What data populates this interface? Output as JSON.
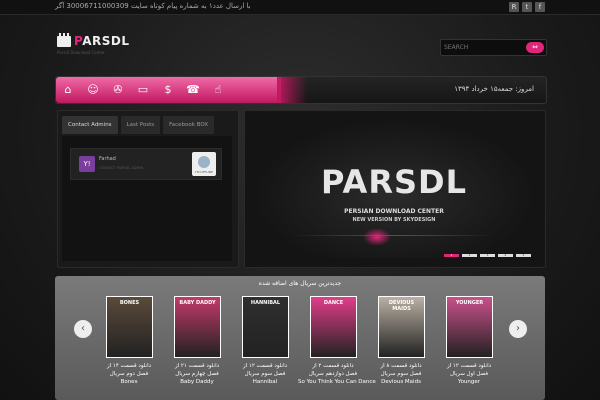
{
  "top_bar": {
    "message": "با ارسال عدد۱ به شماره پیام کوتاه سایت 30006711000309 آگر",
    "social": [
      {
        "icon": "rss-icon",
        "glyph": "R"
      },
      {
        "icon": "twitter-icon",
        "glyph": "t"
      },
      {
        "icon": "facebook-icon",
        "glyph": "f"
      }
    ]
  },
  "header": {
    "logo_initial": "P",
    "logo_rest": "ARSDL",
    "tagline": "Parsdl Download Center",
    "search_placeholder": "SEARCH",
    "search_button": "⇔"
  },
  "nav": {
    "items": [
      {
        "icon": "home-icon",
        "glyph": "⌂"
      },
      {
        "icon": "users-icon",
        "glyph": "☺"
      },
      {
        "icon": "film-reel-icon",
        "glyph": "✇"
      },
      {
        "icon": "tv-icon",
        "glyph": "▭"
      },
      {
        "icon": "dollar-icon",
        "glyph": "$"
      },
      {
        "icon": "phone-icon",
        "glyph": "☎"
      },
      {
        "icon": "hand-pointer-icon",
        "glyph": "☝"
      }
    ],
    "date": "امروز: جمعه۱۵ خرداد ۱۳۹۴"
  },
  "tabs_panel": {
    "tabs": [
      "Contact Admins",
      "Last Posts",
      "Facebook BOX"
    ],
    "admin": {
      "yahoo_glyph": "Y!",
      "name": "Farhad",
      "subtitle": "CONTACT PARSDL ADMIN",
      "status": "I'M OFFLINE"
    }
  },
  "slider": {
    "title": "PARSDL",
    "subtitle1": "PERSIAN DOWNLOAD CENTER",
    "subtitle2": "NEW VERSION BY SKYDESIGN",
    "dots": [
      "1",
      "2",
      "3",
      "4",
      "5"
    ],
    "active_index": 0
  },
  "series": {
    "title": "جدیدترین سریال های اضافه شده",
    "items": [
      {
        "line1": "دانلود قسمت ۱۴ از",
        "line2": "فصل دوم سریال",
        "name": "Bones",
        "poster_text": "BONES",
        "color": "#5a4a3a"
      },
      {
        "line1": "دانلود قسمت ۲۱ از",
        "line2": "فصل چهارم سریال",
        "name": "Baby Daddy",
        "poster_text": "BABY DADDY",
        "color": "#c23a6a"
      },
      {
        "line1": "دانلود قسمت ۱۲ از",
        "line2": "فصل سوم سریال",
        "name": "Hannibal",
        "poster_text": "HANNIBAL",
        "color": "#2f2f2f"
      },
      {
        "line1": "دانلود قسمت ۲ از",
        "line2": "فصل دوازدهم سریال",
        "name": "So You Think You Can Dance",
        "poster_text": "DANCE",
        "color": "#e23d8a"
      },
      {
        "line1": "دانلود قسمت ۸ از",
        "line2": "فصل سوم سریال",
        "name": "Devious Maids",
        "poster_text": "DEVIOUS MAIDS",
        "color": "#b9b0a3"
      },
      {
        "line1": "دانلود قسمت ۱۲ از",
        "line2": "فصل اول سریال",
        "name": "Younger",
        "poster_text": "YOUNGER",
        "color": "#c9508a"
      }
    ]
  }
}
